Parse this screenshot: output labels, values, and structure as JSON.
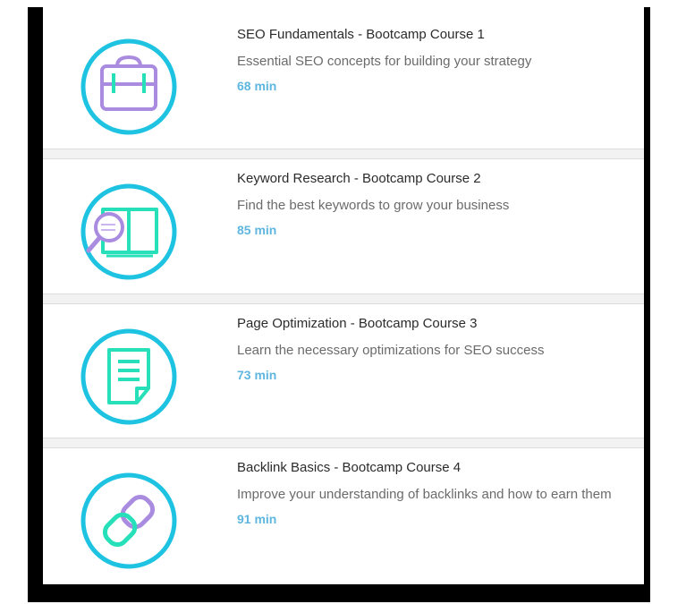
{
  "colors": {
    "ring": "#1ec3e2",
    "purple": "#a98be0",
    "teal": "#27e0b9",
    "duration": "#5fb6de"
  },
  "courses": [
    {
      "title": "SEO Fundamentals - Bootcamp Course 1",
      "description": "Essential SEO concepts for building your strategy",
      "duration": "68 min",
      "icon": "briefcase-icon"
    },
    {
      "title": "Keyword Research - Bootcamp Course 2",
      "description": "Find the best keywords to grow your business",
      "duration": "85 min",
      "icon": "book-magnifier-icon"
    },
    {
      "title": "Page Optimization - Bootcamp Course 3",
      "description": "Learn the necessary optimizations for SEO success",
      "duration": "73 min",
      "icon": "document-icon"
    },
    {
      "title": "Backlink Basics - Bootcamp Course 4",
      "description": "Improve your understanding of backlinks and how to earn them",
      "duration": "91 min",
      "icon": "chain-link-icon"
    }
  ]
}
